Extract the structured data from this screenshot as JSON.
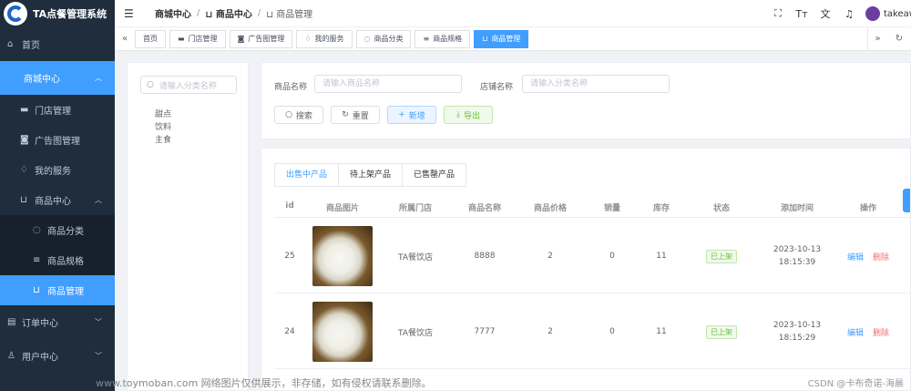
{
  "app": {
    "title": "TA点餐管理系统"
  },
  "sidebar": {
    "home": "首页",
    "mall_center": "商城中心",
    "store_mgmt": "门店管理",
    "ad_mgmt": "广告图管理",
    "my_services": "我的服务",
    "product_center": "商品中心",
    "product_category": "商品分类",
    "product_spec": "商品规格",
    "product_mgmt": "商品管理",
    "order_center": "订单中心",
    "user_center": "用户中心"
  },
  "header": {
    "breadcrumb": [
      "商城中心",
      "商品中心",
      "商品管理"
    ],
    "username": "takeaw"
  },
  "tags": [
    "首页",
    "门店管理",
    "广告图管理",
    "我的服务",
    "商品分类",
    "商品规格",
    "商品管理"
  ],
  "category": {
    "search_placeholder": "请输入分类名称",
    "nodes": [
      "甜点",
      "饮料",
      "主食"
    ]
  },
  "search": {
    "product_name_label": "商品名称",
    "product_name_placeholder": "请输入商品名称",
    "store_name_label": "店铺名称",
    "store_name_placeholder": "请输入分类名称",
    "search_btn": "搜索",
    "reset_btn": "重置",
    "add_btn": "新增",
    "export_btn": "导出"
  },
  "tabs": [
    "出售中产品",
    "待上架产品",
    "已售罄产品"
  ],
  "table": {
    "columns": [
      "id",
      "商品图片",
      "所属门店",
      "商品名称",
      "商品价格",
      "销量",
      "库存",
      "状态",
      "添加时间",
      "操作"
    ],
    "rows": [
      {
        "id": "25",
        "store": "TA餐饮店",
        "name": "8888",
        "price": "2",
        "sales": "0",
        "stock": "11",
        "status": "已上架",
        "date": "2023-10-13",
        "time": "18:15:39",
        "edit": "编辑",
        "delete": "删除"
      },
      {
        "id": "24",
        "store": "TA餐饮店",
        "name": "7777",
        "price": "2",
        "sales": "0",
        "stock": "11",
        "status": "已上架",
        "date": "2023-10-13",
        "time": "18:15:29",
        "edit": "编辑",
        "delete": "删除"
      }
    ]
  },
  "watermark": {
    "left": "www.toymoban.com 网络图片仅供展示，非存储，如有侵权请联系删除。",
    "right": "CSDN @卡布奇诺-海晨"
  },
  "colors": {
    "primary": "#409eff",
    "sidebar": "#1f2d3d",
    "success": "#67c23a",
    "danger": "#f56c6c"
  }
}
